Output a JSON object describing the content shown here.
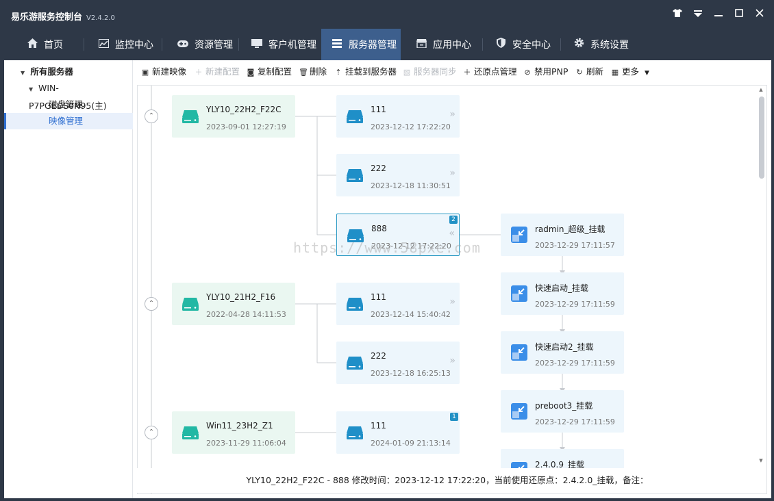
{
  "app": {
    "title": "易乐游服务控制台",
    "version": "V2.4.2.0"
  },
  "window_controls": {
    "skin_icon": "shirt-icon",
    "menu_icon": "dropdown-triangle-icon",
    "minimize_icon": "minimize-icon",
    "maximize_icon": "maximize-icon",
    "close_icon": "close-icon"
  },
  "nav": {
    "items": [
      {
        "label": "首页",
        "icon": "home-icon"
      },
      {
        "label": "监控中心",
        "icon": "chart-icon"
      },
      {
        "label": "资源管理",
        "icon": "gamepad-icon"
      },
      {
        "label": "客户机管理",
        "icon": "monitor-icon"
      },
      {
        "label": "服务器管理",
        "icon": "server-icon",
        "active": true
      },
      {
        "label": "应用中心",
        "icon": "store-icon"
      },
      {
        "label": "安全中心",
        "icon": "shield-icon"
      },
      {
        "label": "系统设置",
        "icon": "gear-icon"
      }
    ]
  },
  "sidebar": {
    "root": "所有服务器",
    "server": "WIN-P7PGEDS0N95(主)",
    "children": [
      "磁盘管理",
      "映像管理"
    ],
    "selected": "映像管理"
  },
  "toolbar": {
    "items": [
      {
        "label": "新建映像",
        "enabled": true
      },
      {
        "label": "新建配置",
        "enabled": false
      },
      {
        "label": "复制配置",
        "enabled": true
      },
      {
        "label": "删除",
        "enabled": true
      },
      {
        "label": "挂载到服务器",
        "enabled": true
      },
      {
        "label": "服务器同步",
        "enabled": false
      },
      {
        "label": "还原点管理",
        "enabled": true
      },
      {
        "label": "禁用PNP",
        "enabled": true
      },
      {
        "label": "刷新",
        "enabled": true
      },
      {
        "label": "更多",
        "enabled": true
      }
    ]
  },
  "tree": {
    "groups": [
      {
        "base": {
          "name": "YLY10_22H2_F22C",
          "date": "2023-09-01 12:27:19"
        },
        "configs": [
          {
            "name": "111",
            "date": "2023-12-12 17:22:20"
          },
          {
            "name": "222",
            "date": "2023-12-18 11:30:51"
          },
          {
            "name": "888",
            "date": "2023-12-12 17:22:20",
            "badge": "2",
            "selected": true
          }
        ]
      },
      {
        "base": {
          "name": "YLY10_21H2_F16",
          "date": "2022-04-28 14:11:53"
        },
        "configs": [
          {
            "name": "111",
            "date": "2023-12-14 15:40:42"
          },
          {
            "name": "222",
            "date": "2023-12-18 16:25:13"
          }
        ]
      },
      {
        "base": {
          "name": "Win11_23H2_Z1",
          "date": "2023-11-29 11:06:04"
        },
        "configs": [
          {
            "name": "111",
            "date": "2024-01-09 21:13:14",
            "badge": "1"
          }
        ]
      }
    ],
    "restore_points": [
      {
        "name": "radmin_超级_挂载",
        "date": "2023-12-29 17:11:57"
      },
      {
        "name": "快速启动_挂载",
        "date": "2023-12-29 17:11:59"
      },
      {
        "name": "快速启动2_挂载",
        "date": "2023-12-29 17:11:59"
      },
      {
        "name": "preboot3_挂载",
        "date": "2023-12-29 17:11:59"
      },
      {
        "name": "2.4.0.9_挂载",
        "date": ""
      }
    ]
  },
  "watermark": "https://www.58pxe.com",
  "status": "YLY10_22H2_F22C - 888 修改时间：2023-12-12 17:22:20，当前使用还原点：2.4.2.0_挂载，备注："
}
